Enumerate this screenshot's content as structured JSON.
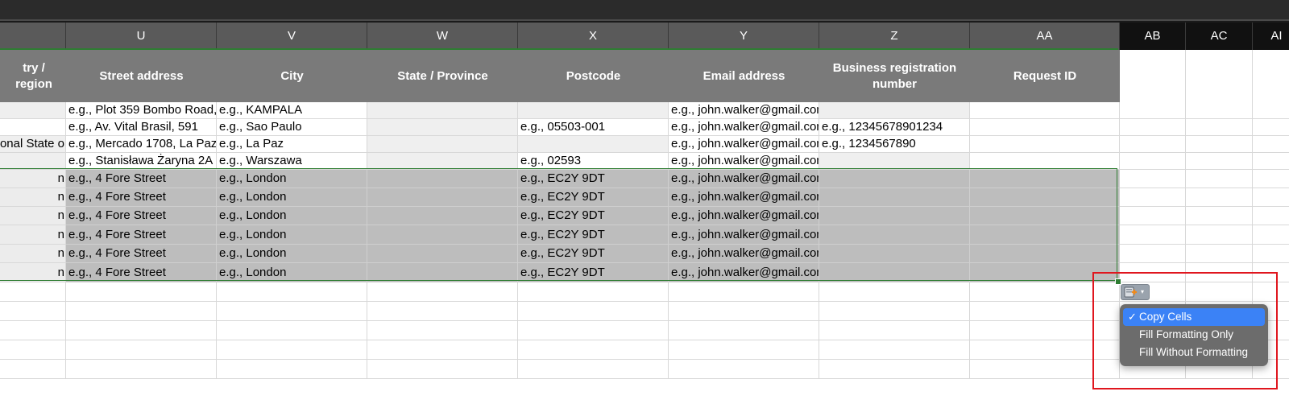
{
  "columns": [
    {
      "letter": "",
      "header": "try / region",
      "style": "gray"
    },
    {
      "letter": "U",
      "header": "Street address",
      "style": "gray"
    },
    {
      "letter": "V",
      "header": "City",
      "style": "gray"
    },
    {
      "letter": "W",
      "header": "State / Province",
      "style": "gray"
    },
    {
      "letter": "X",
      "header": "Postcode",
      "style": "gray"
    },
    {
      "letter": "Y",
      "header": "Email address",
      "style": "gray"
    },
    {
      "letter": "Z",
      "header": "Business registration number",
      "style": "gray"
    },
    {
      "letter": "AA",
      "header": "Request ID",
      "style": "gray"
    },
    {
      "letter": "AB",
      "header": "",
      "style": "dark"
    },
    {
      "letter": "AC",
      "header": "",
      "style": "dark"
    },
    {
      "letter": "AI",
      "header": "",
      "style": "dark"
    }
  ],
  "rows": [
    [
      "",
      "e.g., Plot 359 Bombo Road,",
      "e.g., KAMPALA",
      "",
      "",
      "e.g., john.walker@gmail.com",
      "",
      "",
      "",
      "",
      ""
    ],
    [
      "",
      "e.g., Av. Vital Brasil, 591",
      "e.g., Sao Paulo",
      "",
      "e.g., 05503-001",
      "e.g., john.walker@gmail.com",
      "e.g., 12345678901234",
      "",
      "",
      "",
      ""
    ],
    [
      "tional State o",
      "e.g., Mercado 1708, La Paz",
      "e.g., La Paz",
      "",
      "",
      "e.g., john.walker@gmail.com",
      "e.g., 1234567890",
      "",
      "",
      "",
      ""
    ],
    [
      "",
      "e.g., Stanisława Żaryna 2A",
      "e.g., Warszawa",
      "",
      "e.g., 02593",
      "e.g., john.walker@gmail.com",
      "",
      "",
      "",
      "",
      ""
    ],
    [
      "n",
      "e.g., 4 Fore Street",
      "e.g., London",
      "",
      "e.g., EC2Y 9DT",
      "e.g., john.walker@gmail.com",
      "",
      "",
      "",
      "",
      ""
    ],
    [
      "n",
      "e.g., 4 Fore Street",
      "e.g., London",
      "",
      "e.g., EC2Y 9DT",
      "e.g., john.walker@gmail.com",
      "",
      "",
      "",
      "",
      ""
    ],
    [
      "n",
      "e.g., 4 Fore Street",
      "e.g., London",
      "",
      "e.g., EC2Y 9DT",
      "e.g., john.walker@gmail.com",
      "",
      "",
      "",
      "",
      ""
    ],
    [
      "n",
      "e.g., 4 Fore Street",
      "e.g., London",
      "",
      "e.g., EC2Y 9DT",
      "e.g., john.walker@gmail.com",
      "",
      "",
      "",
      "",
      ""
    ],
    [
      "n",
      "e.g., 4 Fore Street",
      "e.g., London",
      "",
      "e.g., EC2Y 9DT",
      "e.g., john.walker@gmail.com",
      "",
      "",
      "",
      "",
      ""
    ],
    [
      "n",
      "e.g., 4 Fore Street",
      "e.g., London",
      "",
      "e.g., EC2Y 9DT",
      "e.g., john.walker@gmail.com",
      "",
      "",
      "",
      "",
      ""
    ]
  ],
  "autofill": {
    "menu_items": [
      {
        "label": "Copy Cells",
        "checked": true
      },
      {
        "label": "Fill Formatting Only",
        "checked": false
      },
      {
        "label": "Fill Without Formatting",
        "checked": false
      }
    ],
    "check_glyph": "✓",
    "arrow_glyph": "▾"
  },
  "colors": {
    "selection_border": "#2e7d32",
    "highlight_box": "#e0161e",
    "menu_active": "#3b82f6"
  }
}
